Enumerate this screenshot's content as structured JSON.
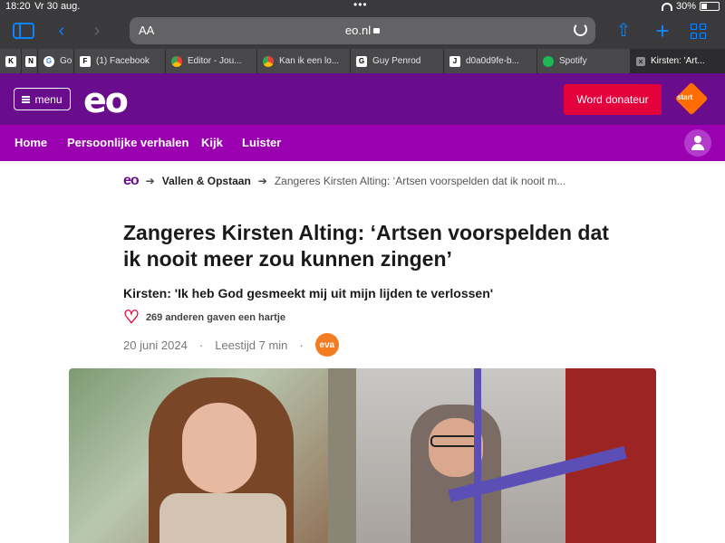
{
  "statusbar": {
    "time": "18:20",
    "date": "Vr 30 aug.",
    "battery": "30%"
  },
  "toolbar": {
    "text_size": "AA",
    "url": "eo.nl"
  },
  "tabs": [
    {
      "label": "",
      "icon": "k-favicon"
    },
    {
      "label": "",
      "icon": "notion-favicon"
    },
    {
      "label": "Go",
      "icon": "google-icon"
    },
    {
      "label": "(1) Facebook",
      "icon": "f-favicon"
    },
    {
      "label": "Editor - Jou...",
      "icon": "chrome-icon"
    },
    {
      "label": "Kan ik een lo...",
      "icon": "chrome-icon"
    },
    {
      "label": "Guy Penrod",
      "icon": "g-favicon"
    },
    {
      "label": "d0a0d9fe-b...",
      "icon": "j-favicon"
    },
    {
      "label": "Spotify",
      "icon": "spotify-icon"
    },
    {
      "label": "Kirsten: 'Art...",
      "icon": "close-icon"
    }
  ],
  "header": {
    "menu_label": "menu",
    "logo": "eo",
    "donate_label": "Word donateur",
    "npo_label": "start"
  },
  "nav": {
    "items": [
      "Home",
      "Persoonlijke verhalen",
      "Kijk",
      "Luister"
    ]
  },
  "article": {
    "breadcrumb": {
      "home": "eo",
      "section": "Vallen & Opstaan",
      "current": "Zangeres Kirsten Alting: ‘Artsen voorspelden dat ik nooit m..."
    },
    "title": "Zangeres Kirsten Alting: ‘Artsen voorspelden dat ik nooit meer zou kunnen zingen’",
    "subtitle": "Kirsten: 'Ik heb God gesmeekt mij uit mijn lijden te verlossen'",
    "likes": "269 anderen gaven een hartje",
    "date": "20 juni 2024",
    "dot": "·",
    "reading_time": "Leestijd 7 min",
    "author_badge": "eva"
  },
  "colors": {
    "header": "#6a0d8c",
    "nav": "#9b00b0",
    "donate": "#e4003a",
    "badge": "#f47c20"
  }
}
